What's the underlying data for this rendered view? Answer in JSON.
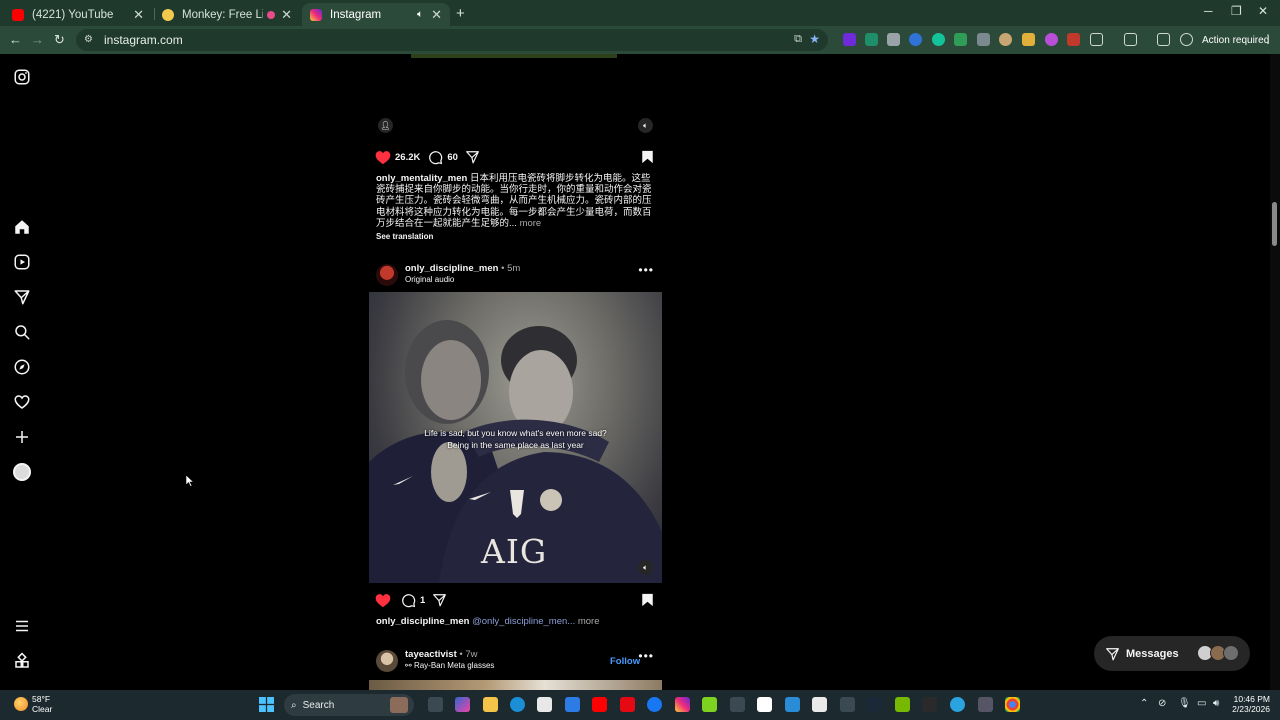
{
  "browser": {
    "tabs": [
      {
        "title": "(4221) YouTube",
        "active": false,
        "favicon_color": "#ff0000"
      },
      {
        "title": "Monkey: Free Live Video Ch",
        "active": false,
        "favicon_color": "#f2c94c"
      },
      {
        "title": "Instagram",
        "active": true,
        "favicon_color": "#d62976"
      }
    ],
    "address": "instagram.com",
    "action_required": "Action required"
  },
  "feed": {
    "post1": {
      "likes": "26.2K",
      "comments": "60",
      "username": "only_mentality_men",
      "caption": "日本利用压电瓷砖将脚步转化为电能。这些瓷砖捕捉来自你脚步的动能。当你行走时，你的重量和动作会对瓷砖产生压力。瓷砖会轻微弯曲，从而产生机械应力。瓷砖内部的压电材料将这种应力转化为电能。每一步都会产生少量电荷，而数百万步结合在一起就能产生足够的...",
      "more": "more",
      "see_translation": "See translation"
    },
    "post2": {
      "username": "only_discipline_men",
      "time": "5m",
      "audio": "Original audio",
      "subtitle_line1": "Life is sad, but you know what's even more sad?",
      "subtitle_line2": "Being in the same place as last year",
      "jersey_text": "AIG",
      "comments": "1",
      "caption_mention": "@only_discipline_men...",
      "more": "more"
    },
    "post3": {
      "username": "tayeactivist",
      "time": "7w",
      "audio": "Ray-Ban Meta glasses",
      "follow": "Follow"
    }
  },
  "messages": {
    "label": "Messages"
  },
  "taskbar": {
    "temp": "58°F",
    "condition": "Clear",
    "search": "Search",
    "time": "10:46 PM",
    "date": "2/23/2026"
  },
  "colors": {
    "like": "#ff3040",
    "link": "#4a9dff",
    "chrome_dark": "#1f3a2c",
    "chrome_light": "#2c4a3a"
  }
}
